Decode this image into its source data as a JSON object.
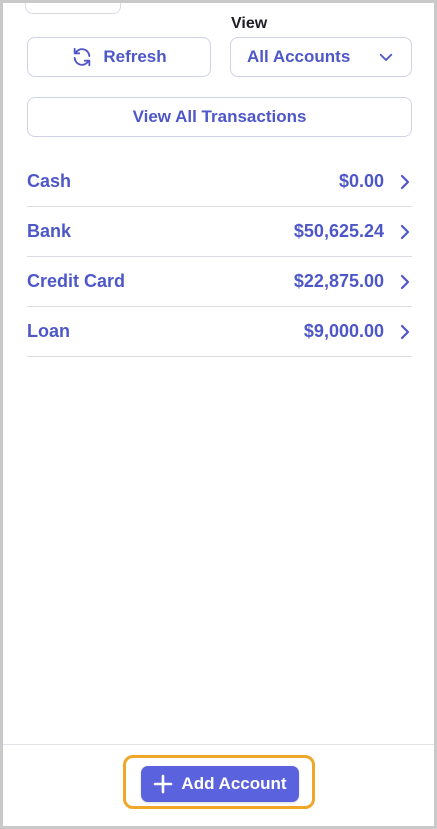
{
  "view": {
    "label": "View",
    "selected": "All Accounts"
  },
  "toolbar": {
    "refresh_label": "Refresh",
    "view_all_label": "View All Transactions"
  },
  "accounts": [
    {
      "name": "Cash",
      "amount": "$0.00"
    },
    {
      "name": "Bank",
      "amount": "$50,625.24"
    },
    {
      "name": "Credit Card",
      "amount": "$22,875.00"
    },
    {
      "name": "Loan",
      "amount": "$9,000.00"
    }
  ],
  "footer": {
    "add_account_label": "Add Account"
  },
  "colors": {
    "accent": "#4e57c8",
    "button_primary": "#5b62dd",
    "highlight": "#f0a629"
  },
  "icons": {
    "refresh": "refresh-icon",
    "dropdown": "chevron-down-icon",
    "row": "chevron-right-icon",
    "add": "plus-icon"
  }
}
